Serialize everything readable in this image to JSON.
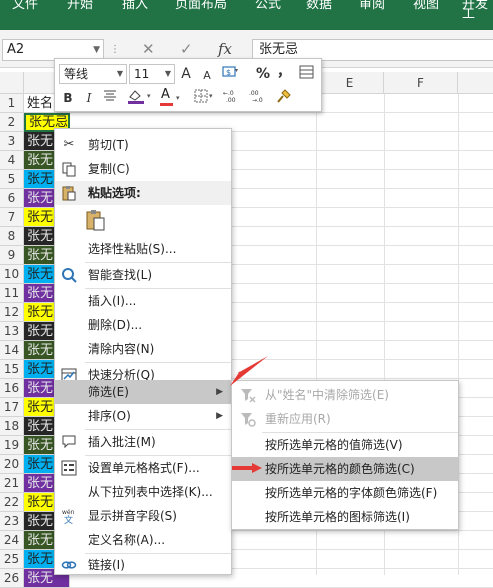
{
  "ribbon": {
    "tabs": [
      "文件",
      "开始",
      "插入",
      "页面布局",
      "公式",
      "数据",
      "审阅",
      "视图",
      "开发工"
    ]
  },
  "formula_bar": {
    "name_box": "A2",
    "content": "张无忌"
  },
  "grid": {
    "col_headers": [
      "E",
      "F"
    ],
    "rows": [
      {
        "num": "1",
        "value": "姓名",
        "fill": "#ffffff"
      },
      {
        "num": "2",
        "value": "张无忌",
        "fill": "#ffff00"
      },
      {
        "num": "3",
        "value": "张无",
        "fill": "#262626"
      },
      {
        "num": "4",
        "value": "张无",
        "fill": "#375623"
      },
      {
        "num": "5",
        "value": "张无",
        "fill": "#00b0f0"
      },
      {
        "num": "6",
        "value": "张无",
        "fill": "#7030a0"
      },
      {
        "num": "7",
        "value": "张无",
        "fill": "#ffff00"
      },
      {
        "num": "8",
        "value": "张无",
        "fill": "#262626"
      },
      {
        "num": "9",
        "value": "张无",
        "fill": "#375623"
      },
      {
        "num": "10",
        "value": "张无",
        "fill": "#00b0f0"
      },
      {
        "num": "11",
        "value": "张无",
        "fill": "#7030a0"
      },
      {
        "num": "12",
        "value": "张无",
        "fill": "#ffff00"
      },
      {
        "num": "13",
        "value": "张无",
        "fill": "#262626"
      },
      {
        "num": "14",
        "value": "张无",
        "fill": "#375623"
      },
      {
        "num": "15",
        "value": "张无",
        "fill": "#00b0f0"
      },
      {
        "num": "16",
        "value": "张无",
        "fill": "#7030a0"
      },
      {
        "num": "17",
        "value": "张无",
        "fill": "#ffff00"
      },
      {
        "num": "18",
        "value": "张无",
        "fill": "#262626"
      },
      {
        "num": "19",
        "value": "张无",
        "fill": "#375623"
      },
      {
        "num": "20",
        "value": "张无",
        "fill": "#00b0f0"
      },
      {
        "num": "21",
        "value": "张无",
        "fill": "#7030a0"
      },
      {
        "num": "22",
        "value": "张无",
        "fill": "#ffff00"
      },
      {
        "num": "23",
        "value": "张无",
        "fill": "#262626"
      },
      {
        "num": "24",
        "value": "张无",
        "fill": "#375623"
      },
      {
        "num": "25",
        "value": "张无",
        "fill": "#00b0f0"
      },
      {
        "num": "26",
        "value": "张无",
        "fill": "#7030a0"
      }
    ]
  },
  "mini_toolbar": {
    "font_name": "等线",
    "font_size": "11",
    "grow_font": "A",
    "shrink_font": "A",
    "percent": "%",
    "comma": "，",
    "bold": "B",
    "italic": "I",
    "font_color_letter": "A"
  },
  "context_menu": {
    "items": [
      {
        "label": "剪切(T)",
        "icon": "scissors-icon"
      },
      {
        "label": "复制(C)",
        "icon": "copy-icon"
      },
      {
        "label": "粘贴选项:",
        "icon": "paste-icon"
      },
      {
        "label": "选择性粘贴(S)...",
        "icon": ""
      },
      {
        "label": "智能查找(L)",
        "icon": "search-icon"
      },
      {
        "label": "插入(I)...",
        "icon": ""
      },
      {
        "label": "删除(D)...",
        "icon": ""
      },
      {
        "label": "清除内容(N)",
        "icon": ""
      },
      {
        "label": "快速分析(Q)",
        "icon": "quick-analysis-icon"
      },
      {
        "label": "筛选(E)",
        "icon": ""
      },
      {
        "label": "排序(O)",
        "icon": ""
      },
      {
        "label": "插入批注(M)",
        "icon": "comment-icon"
      },
      {
        "label": "设置单元格格式(F)...",
        "icon": "format-cells-icon"
      },
      {
        "label": "从下拉列表中选择(K)...",
        "icon": ""
      },
      {
        "label": "显示拼音字段(S)",
        "icon": "phonetic-icon"
      },
      {
        "label": "定义名称(A)...",
        "icon": ""
      },
      {
        "label": "链接(I)",
        "icon": "link-icon"
      }
    ]
  },
  "filter_submenu": {
    "items": [
      {
        "label": "从\"姓名\"中清除筛选(E)",
        "disabled": true
      },
      {
        "label": "重新应用(R)",
        "disabled": true
      },
      {
        "label": "按所选单元格的值筛选(V)",
        "disabled": false
      },
      {
        "label": "按所选单元格的颜色筛选(C)",
        "disabled": false
      },
      {
        "label": "按所选单元格的字体颜色筛选(F)",
        "disabled": false
      },
      {
        "label": "按所选单元格的图标筛选(I)",
        "disabled": false
      }
    ]
  },
  "colors": {
    "ribbon": "#217346",
    "annotation_arrow": "#e53935",
    "menu_highlight": "#c8c8c8"
  }
}
